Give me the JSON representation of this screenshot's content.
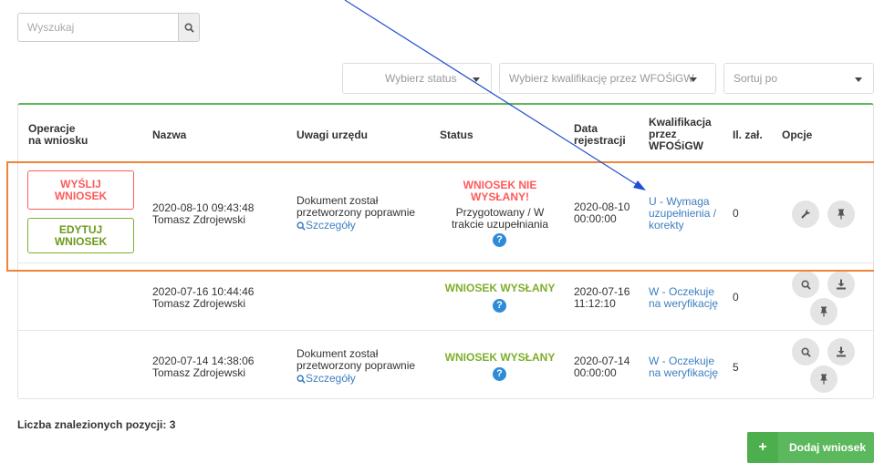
{
  "search": {
    "placeholder": "Wyszukaj"
  },
  "filters": {
    "status_placeholder": "Wybierz status",
    "qualification_placeholder": "Wybierz kwalifikację przez WFOŚiGW",
    "sort_placeholder": "Sortuj po"
  },
  "table": {
    "headers": {
      "operations": "Operacje\nna wniosku",
      "name": "Nazwa",
      "remarks": "Uwagi urzędu",
      "status": "Status",
      "date": "Data\nrejestracji",
      "qualification": "Kwalifikacja\nprzez\nWFOŚiGW",
      "attachments": "Il. zał.",
      "options": "Opcje"
    },
    "rows": [
      {
        "name_date": "2020-08-10 09:43:48",
        "name_user": "Tomasz Zdrojewski",
        "remark": "Dokument został\nprzetworzony poprawnie",
        "details_link": "Szczegóły",
        "status_main": "WNIOSEK NIE\nWYSŁANY!",
        "status_sub": "Przygotowany / W\ntrakcie uzupełniania",
        "reg_date": "2020-08-10\n00:00:00",
        "qualification": "U - Wymaga\nuzupełnienia /\nkorekty",
        "attachments": "0",
        "send_button": "WYŚLIJ\nWNIOSEK",
        "edit_button": "EDYTUJ\nWNIOSEK"
      },
      {
        "name_date": "2020-07-16 10:44:46",
        "name_user": "Tomasz Zdrojewski",
        "status_main": "WNIOSEK WYSŁANY",
        "reg_date": "2020-07-16\n11:12:10",
        "qualification": "W - Oczekuje\nna weryfikację",
        "attachments": "0"
      },
      {
        "name_date": "2020-07-14 14:38:06",
        "name_user": "Tomasz Zdrojewski",
        "remark": "Dokument został\nprzetworzony poprawnie",
        "details_link": "Szczegóły",
        "status_main": "WNIOSEK WYSŁANY",
        "reg_date": "2020-07-14\n00:00:00",
        "qualification": "W - Oczekuje\nna weryfikację",
        "attachments": "5"
      }
    ],
    "help_glyph": "?"
  },
  "footer": {
    "count_label": "Liczba znalezionych pozycji: 3",
    "add_button": "Dodaj wniosek",
    "add_glyph": "+"
  },
  "colors": {
    "accent_green": "#5cb85c",
    "status_red": "#ff5a5a",
    "status_green": "#7fae2b",
    "link_blue": "#3d7fc1",
    "highlight_orange": "#f0843a"
  }
}
